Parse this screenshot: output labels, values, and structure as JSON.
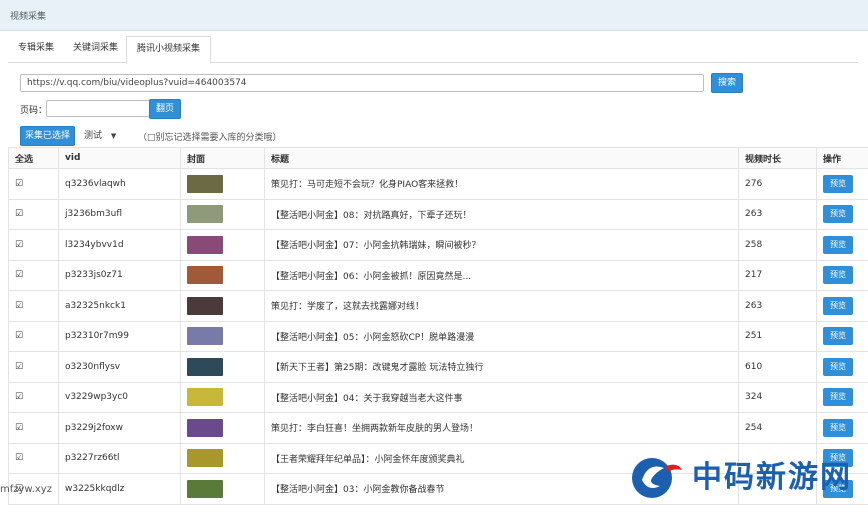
{
  "window": {
    "title": "视频采集"
  },
  "tabs": [
    {
      "label": "专辑采集",
      "active": false
    },
    {
      "label": "关键词采集",
      "active": false
    },
    {
      "label": "腾讯小视频采集",
      "active": true
    }
  ],
  "search": {
    "url_value": "https://v.qq.com/biu/videoplus?vuid=464003574",
    "button_label": "搜索"
  },
  "paging": {
    "label": "页码：",
    "input_value": "",
    "button_label": "翻页"
  },
  "actions": {
    "collect_selected_label": "采集已选择",
    "category_value": "测试",
    "hint": "（□别忘记选择需要入库的分类哦）"
  },
  "table": {
    "headers": {
      "select_all": "全选",
      "vid": "vid",
      "cover": "封面",
      "title": "标题",
      "duration": "视频时长",
      "ops": "操作"
    },
    "preview_label": "预览",
    "rows": [
      {
        "checked": true,
        "vid": "q3236vlaqwh",
        "title": "策见打：马可走短不会玩？化身PIAO客来拯救！",
        "duration": "276",
        "thumb_color": "#6b6a44"
      },
      {
        "checked": true,
        "vid": "j3236bm3ufl",
        "title": "【整活吧小阿金】08：对抗路真好，下辈子还玩！",
        "duration": "263",
        "thumb_color": "#8f9a7a"
      },
      {
        "checked": true,
        "vid": "l3234ybvv1d",
        "title": "【整活吧小阿金】07：小阿金抗韩瑞妹，瞬间被秒？",
        "duration": "258",
        "thumb_color": "#8a4a78"
      },
      {
        "checked": true,
        "vid": "p3233js0z71",
        "title": "【整活吧小阿金】06：小阿金被抓！原因竟然是...",
        "duration": "217",
        "thumb_color": "#a05a3a"
      },
      {
        "checked": true,
        "vid": "a32325nkck1",
        "title": "策见打：学废了，这就去找露娜对线！",
        "duration": "263",
        "thumb_color": "#4a3a3a"
      },
      {
        "checked": true,
        "vid": "p32310r7m99",
        "title": "【整活吧小阿金】05：小阿金怒砍CP！脱单路漫漫",
        "duration": "251",
        "thumb_color": "#7a7aa8"
      },
      {
        "checked": true,
        "vid": "o3230nflysv",
        "title": "【新天下王者】第25期：改键鬼才露脸 玩法特立独行",
        "duration": "610",
        "thumb_color": "#2e4a5a"
      },
      {
        "checked": true,
        "vid": "v3229wp3yc0",
        "title": "【整活吧小阿金】04：关于我穿越当老大这件事",
        "duration": "324",
        "thumb_color": "#c8b83a"
      },
      {
        "checked": true,
        "vid": "p3229j2foxw",
        "title": "策见打：李白狂喜！坐拥两款新年皮肤的男人登场！",
        "duration": "254",
        "thumb_color": "#6a4a8a"
      },
      {
        "checked": true,
        "vid": "p3227rz66tl",
        "title": "【王者荣耀拜年纪单品】：小阿金怀年度颁奖典礼",
        "duration": "",
        "thumb_color": "#a8982a"
      },
      {
        "checked": true,
        "vid": "w3225kkqdlz",
        "title": "【整活吧小阿金】03：小阿金教你备战春节",
        "duration": "",
        "thumb_color": "#5a7a3a"
      }
    ]
  },
  "watermark": {
    "text": "mfzyw.xyz",
    "brand": "中码新游网"
  },
  "colors": {
    "accent": "#2f8fd8",
    "titlebar_bg": "#e8f1f8",
    "brand_blue": "#1b5fae",
    "brand_red": "#e0201e"
  }
}
